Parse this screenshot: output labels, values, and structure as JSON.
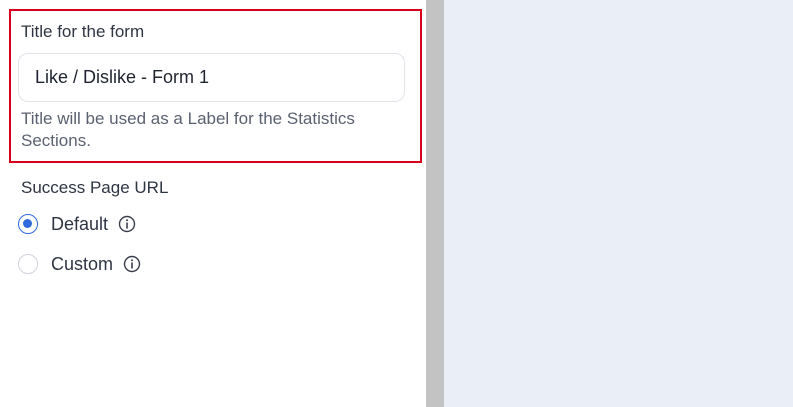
{
  "form_title": {
    "label": "Title for the form",
    "value": "Like / Dislike - Form 1",
    "help": "Title will be used as a Label for the Statistics Sections."
  },
  "success_page": {
    "label": "Success Page URL",
    "options": [
      {
        "label": "Default",
        "selected": true
      },
      {
        "label": "Custom",
        "selected": false
      }
    ]
  },
  "colors": {
    "highlight": "#d6001c",
    "accent": "#2f6bdc",
    "divider": "#c3c3c3",
    "right_panel_bg": "#eaeef7"
  },
  "icons": {
    "info": "info-circle-icon"
  }
}
